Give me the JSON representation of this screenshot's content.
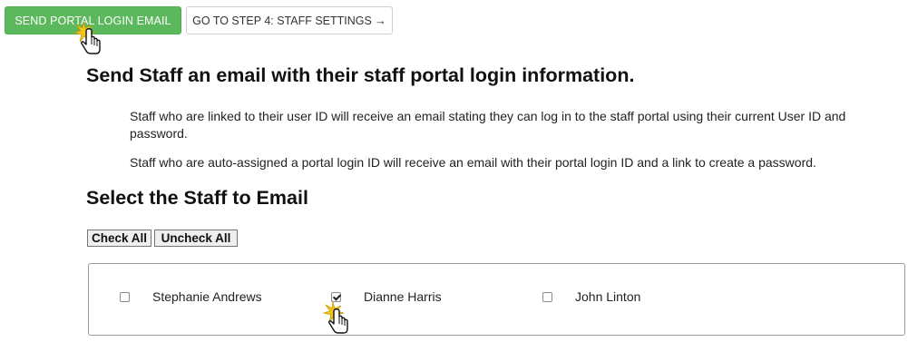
{
  "toolbar": {
    "send_email_label": "SEND PORTAL LOGIN EMAIL",
    "next_step_label": "GO TO STEP 4: STAFF SETTINGS",
    "next_step_icon": "arrow-right-icon"
  },
  "intro": {
    "title": "Send Staff an email with their staff portal login information.",
    "paragraphs": [
      "Staff who are linked to their user ID will receive an email stating they can log in to the staff portal using their current User ID and password.",
      "Staff who are auto-assigned a portal login ID will receive an email with their portal login ID and a link to create a password."
    ]
  },
  "select": {
    "title": "Select the Staff to Email",
    "check_all_label": "Check All",
    "uncheck_all_label": "Uncheck All"
  },
  "staff": [
    {
      "name": "Stephanie Andrews",
      "checked": false
    },
    {
      "name": "Dianne Harris",
      "checked": true
    },
    {
      "name": "John Linton",
      "checked": false
    }
  ],
  "colors": {
    "primary_button": "#5cb85c",
    "cursor_burst": "#f5c518"
  },
  "icons": {
    "click_cursor": "hand-pointer-icon",
    "click_highlight": "click-burst-icon"
  }
}
